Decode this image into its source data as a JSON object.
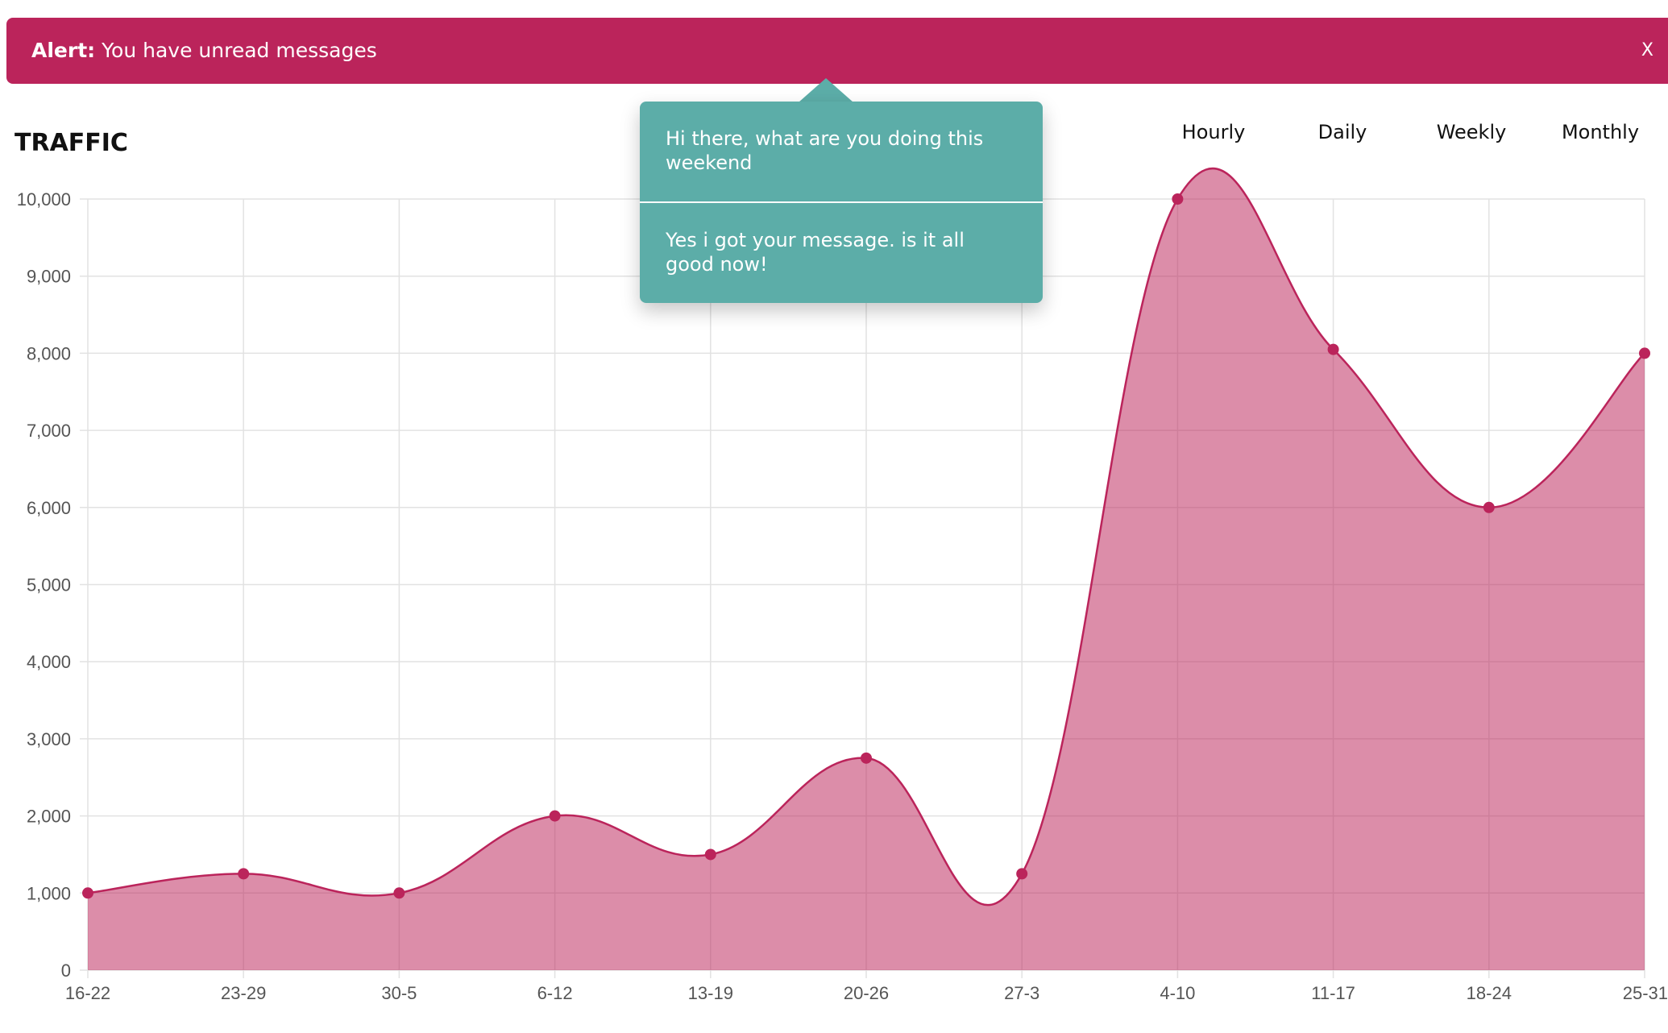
{
  "alert": {
    "label": "Alert:",
    "message": "You have unread messages",
    "close_label": "X",
    "color": "#bb245b"
  },
  "popup": {
    "color": "#5cada8",
    "messages": [
      "Hi there, what are you doing this weekend",
      "Yes i got your message. is it all good now!"
    ]
  },
  "traffic": {
    "title": "TRAFFIC",
    "tabs": [
      "Hourly",
      "Daily",
      "Weekly",
      "Monthly"
    ]
  },
  "chart_data": {
    "type": "area",
    "title": "",
    "xlabel": "",
    "ylabel": "",
    "categories": [
      "16-22",
      "23-29",
      "30-5",
      "6-12",
      "13-19",
      "20-26",
      "27-3",
      "4-10",
      "11-17",
      "18-24",
      "25-31"
    ],
    "series": [
      {
        "values": [
          1000,
          1250,
          1000,
          2000,
          1500,
          2750,
          1250,
          10000,
          8050,
          6000,
          8000
        ]
      }
    ],
    "ylim": [
      0,
      10000
    ],
    "yticks": [
      0,
      1000,
      2000,
      3000,
      4000,
      5000,
      6000,
      7000,
      8000,
      9000,
      10000
    ],
    "ytick_labels": [
      "0",
      "1,000",
      "2,000",
      "3,000",
      "4,000",
      "5,000",
      "6,000",
      "7,000",
      "8,000",
      "9,000",
      "10,000"
    ],
    "grid": true,
    "line_color": "#bb245b",
    "fill_color": "rgba(187,36,91,0.52)"
  }
}
